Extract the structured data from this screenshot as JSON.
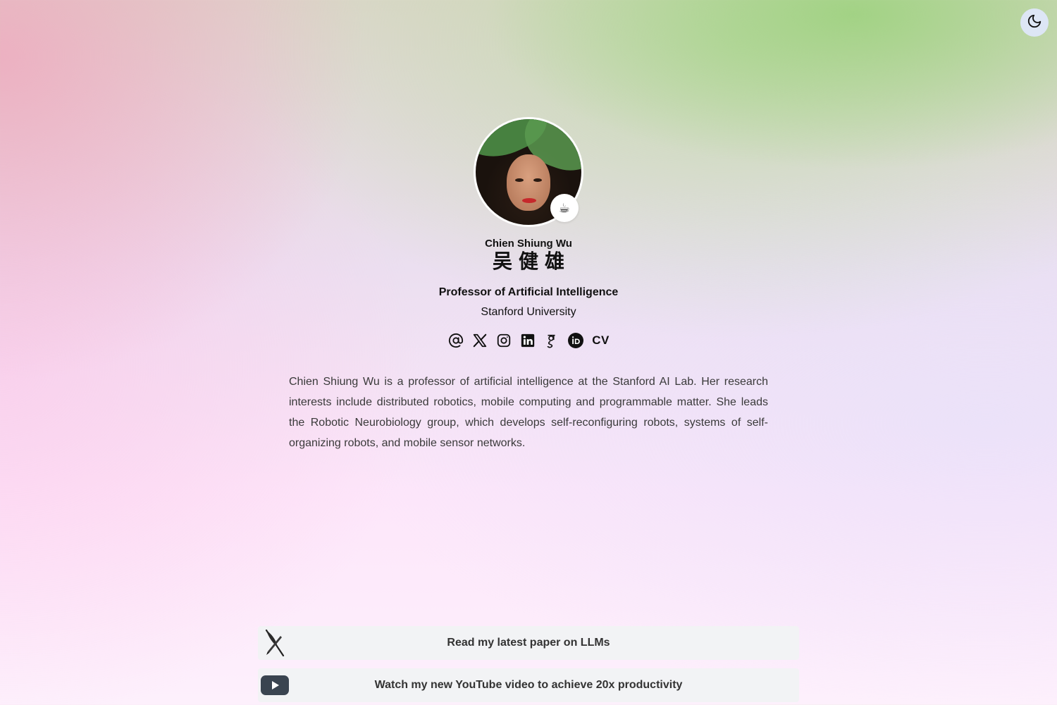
{
  "header": {
    "theme_toggle_icon": "moon-icon"
  },
  "profile": {
    "avatar_badge_emoji": "☕",
    "name": "Chien Shiung Wu",
    "name_chinese": "吴健雄",
    "title": "Professor of Artificial Intelligence",
    "affiliation": "Stanford University",
    "social_links": [
      {
        "name": "email",
        "icon": "at-icon"
      },
      {
        "name": "x",
        "icon": "x-twitter-icon"
      },
      {
        "name": "instagram",
        "icon": "instagram-icon"
      },
      {
        "name": "linkedin",
        "icon": "linkedin-icon"
      },
      {
        "name": "google-scholar",
        "icon": "google-scholar-icon"
      },
      {
        "name": "orcid",
        "icon": "orcid-icon"
      }
    ],
    "cv_label": "CV",
    "bio": "Chien Shiung Wu is a professor of artificial intelligence at the Stanford AI Lab. Her research interests include distributed robotics, mobile computing and programmable matter. She leads the Robotic Neurobiology group, which develops self-reconfiguring robots, systems of self-organizing robots, and mobile sensor networks."
  },
  "links": [
    {
      "label": "Read my latest paper on LLMs",
      "icon": "feather-pen-icon"
    },
    {
      "label": "Watch my new YouTube video to achieve 20x productivity",
      "icon": "youtube-icon"
    }
  ],
  "colors": {
    "accent_green": "#a6d38a",
    "accent_pink": "#f0b4c8",
    "button_bg": "#f2f3f5",
    "toggle_bg": "#dde6f5",
    "youtube_dark": "#3a4450"
  }
}
